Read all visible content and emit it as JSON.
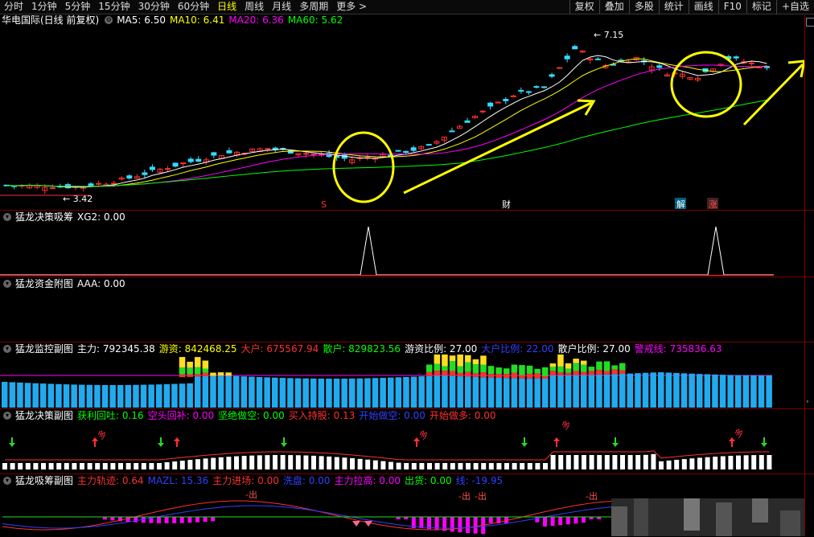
{
  "toolbar": {
    "items": [
      "分时",
      "1分钟",
      "5分钟",
      "15分钟",
      "30分钟",
      "60分钟",
      "日线",
      "周线",
      "月线",
      "多周期",
      "更多 >"
    ],
    "active_index": 6,
    "right_items": [
      "复权",
      "叠加",
      "多股",
      "统计",
      "画线",
      "F10",
      "标记",
      "+自选"
    ]
  },
  "main_panel": {
    "stock_name": "华电国际(日线 前复权)",
    "ma": [
      {
        "label": "MA5: 6.50",
        "color": "#ffffff"
      },
      {
        "label": "MA10: 6.41",
        "color": "#ffff00"
      },
      {
        "label": "MA20: 6.36",
        "color": "#ff00ff"
      },
      {
        "label": "MA60: 5.62",
        "color": "#00ff00"
      }
    ],
    "high_label": "7.15",
    "low_label": "3.42",
    "markers": [
      {
        "text": "S",
        "color": "#ff3030"
      },
      {
        "text": "财",
        "color": "#ffffff"
      },
      {
        "text": "解",
        "color": "#ffffff"
      },
      {
        "text": "涨",
        "color": "#ff5050"
      }
    ]
  },
  "panel_xg": {
    "title": "猛龙决策吸筹",
    "value": "XG2: 0.00"
  },
  "panel_aaa": {
    "title": "猛龙资金附图",
    "value": "AAA: 0.00"
  },
  "panel_monitor": {
    "title": "猛龙监控副图",
    "items": [
      {
        "label": "主力: 792345.38",
        "color": "#ffffff"
      },
      {
        "label": "游资: 842468.25",
        "color": "#ffff00"
      },
      {
        "label": "大户: 675567.94",
        "color": "#ff3030"
      },
      {
        "label": "散户: 829823.56",
        "color": "#00ff00"
      },
      {
        "label": "游资比例: 27.00",
        "color": "#ffffff"
      },
      {
        "label": "大户比例: 22.00",
        "color": "#3040ff"
      },
      {
        "label": "散户比例: 27.00",
        "color": "#ffffff"
      },
      {
        "label": "警戒线: 735836.63",
        "color": "#ff00ff"
      }
    ]
  },
  "panel_decision": {
    "title": "猛龙决策副图",
    "items": [
      {
        "label": "获利回吐: 0.16",
        "color": "#00ff00"
      },
      {
        "label": "空头回补: 0.00",
        "color": "#ff00ff"
      },
      {
        "label": "坚绝做空: 0.00",
        "color": "#00ff00"
      },
      {
        "label": "买入持股: 0.13",
        "color": "#ff3030"
      },
      {
        "label": "开始做空: 0.00",
        "color": "#3040ff"
      },
      {
        "label": "开始做多: 0.00",
        "color": "#ff3030"
      }
    ],
    "buy_text": "多"
  },
  "panel_absorb": {
    "title": "猛龙吸筹副图",
    "items": [
      {
        "label": "主力轨迹: 0.64",
        "color": "#ff3030"
      },
      {
        "label": "MAZL: 15.36",
        "color": "#3040ff"
      },
      {
        "label": "主力进场: 0.00",
        "color": "#ff3030"
      },
      {
        "label": "洗盘: 0.00",
        "color": "#3040ff"
      },
      {
        "label": "主力拉高: 0.00",
        "color": "#ff00ff"
      },
      {
        "label": "出货: 0.00",
        "color": "#00ff00"
      },
      {
        "label": "线: -19.95",
        "color": "#3040ff"
      }
    ],
    "exit_text": "出"
  }
}
